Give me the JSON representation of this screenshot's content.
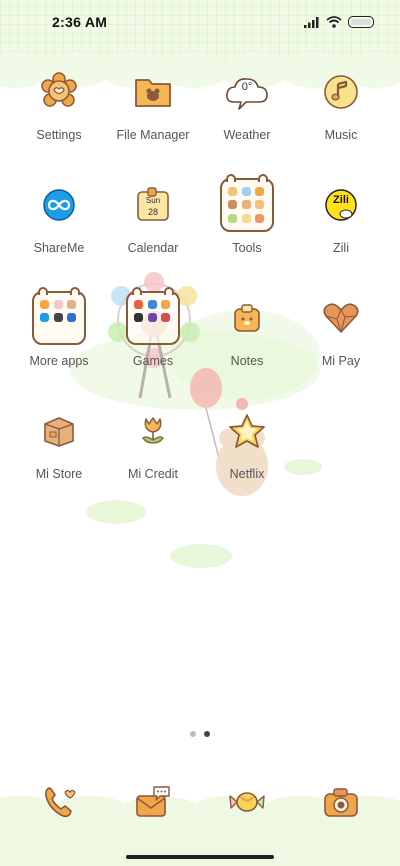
{
  "status": {
    "time": "2:36 AM"
  },
  "apps": [
    {
      "label": "Settings",
      "icon": "flower-icon"
    },
    {
      "label": "File Manager",
      "icon": "folder-icon"
    },
    {
      "label": "Weather",
      "icon": "cloud-icon",
      "icon_text": "0°"
    },
    {
      "label": "Music",
      "icon": "music-note-icon"
    },
    {
      "label": "ShareMe",
      "icon": "infinity-icon"
    },
    {
      "label": "Calendar",
      "icon": "calendar-icon",
      "icon_text_line1": "Sun",
      "icon_text_line2": "28"
    },
    {
      "label": "Tools",
      "icon": "tools-folder-icon"
    },
    {
      "label": "Zili",
      "icon": "zili-icon",
      "icon_text": "Zili"
    },
    {
      "label": "More apps",
      "icon": "more-apps-folder-icon"
    },
    {
      "label": "Games",
      "icon": "games-folder-icon"
    },
    {
      "label": "Notes",
      "icon": "notes-icon"
    },
    {
      "label": "Mi Pay",
      "icon": "heart-icon"
    },
    {
      "label": "Mi Store",
      "icon": "box-icon"
    },
    {
      "label": "Mi Credit",
      "icon": "tulip-icon"
    },
    {
      "label": "Netflix",
      "icon": "star-icon"
    }
  ],
  "pages": {
    "count": 2,
    "active": 1
  },
  "dock": [
    {
      "name": "phone",
      "icon": "phone-icon"
    },
    {
      "name": "messages",
      "icon": "message-icon"
    },
    {
      "name": "browser",
      "icon": "candy-icon"
    },
    {
      "name": "camera",
      "icon": "camera-icon"
    }
  ],
  "colors": {
    "accent_orange": "#f2a64a",
    "outline_brown": "#8a5a3a",
    "mint_green": "#e4f5d4"
  }
}
